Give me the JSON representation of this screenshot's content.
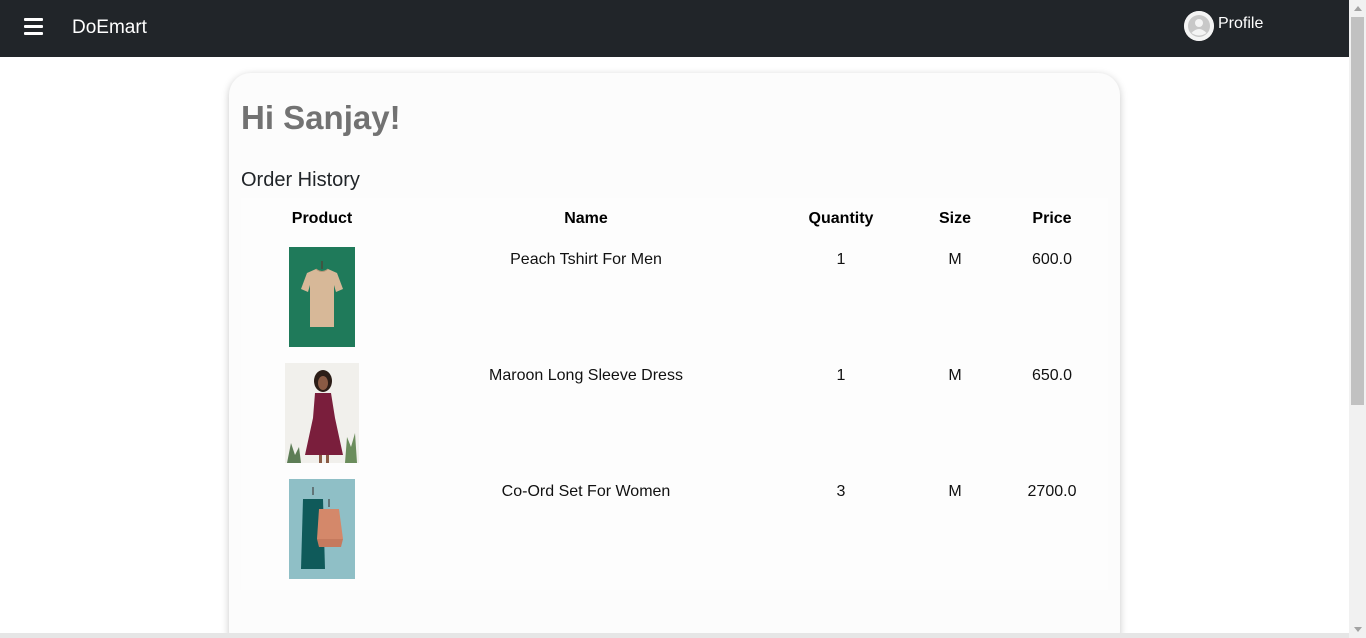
{
  "navbar": {
    "brand": "DoEmart",
    "profile_label": "Profile",
    "menu_icon": "hamburger-menu-icon",
    "avatar_icon": "user-avatar-icon"
  },
  "page": {
    "greeting": "Hi Sanjay!",
    "section_title": "Order History"
  },
  "table": {
    "headers": {
      "product": "Product",
      "name": "Name",
      "quantity": "Quantity",
      "size": "Size",
      "price": "Price"
    },
    "rows": [
      {
        "name": "Peach Tshirt For Men",
        "quantity": "1",
        "size": "M",
        "price": "600.0",
        "image": "peach-tshirt-photo"
      },
      {
        "name": "Maroon Long Sleeve Dress",
        "quantity": "1",
        "size": "M",
        "price": "650.0",
        "image": "maroon-dress-photo"
      },
      {
        "name": "Co-Ord Set For Women",
        "quantity": "3",
        "size": "M",
        "price": "2700.0",
        "image": "coord-set-photo"
      }
    ]
  },
  "colors": {
    "navbar_bg": "#212529",
    "greeting_text": "#727272"
  }
}
